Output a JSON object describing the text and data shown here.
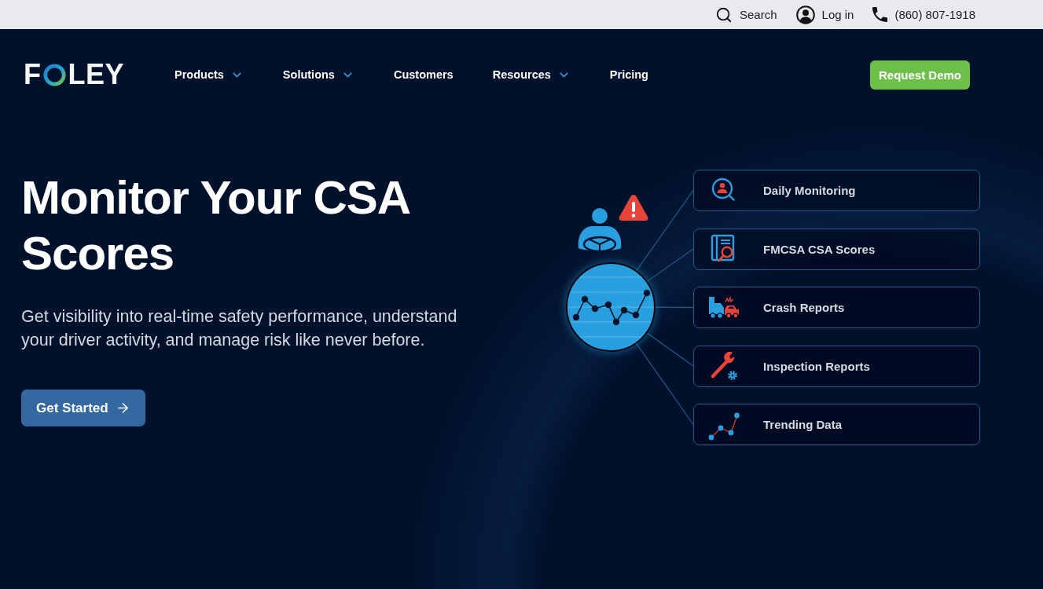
{
  "utility_bar": {
    "items": [
      {
        "kind": "search",
        "label": "Search"
      },
      {
        "kind": "account",
        "label": "Log in"
      },
      {
        "kind": "phone",
        "label": "(860) 807-1918"
      }
    ]
  },
  "nav": {
    "logo": {
      "before": "F",
      "after": "LEY"
    },
    "links": [
      {
        "label": "Products",
        "dropdown": true
      },
      {
        "label": "Solutions",
        "dropdown": true
      },
      {
        "label": "Customers",
        "dropdown": false
      },
      {
        "label": "Resources",
        "dropdown": true
      },
      {
        "label": "Pricing",
        "dropdown": false
      }
    ],
    "cta": "Request Demo"
  },
  "hero": {
    "title": "Monitor Your CSA Scores",
    "subtitle": "Get visibility into real-time safety performance, understand your driver activity, and manage risk like never before.",
    "button": "Get Started"
  },
  "features": [
    {
      "kind": "monitoring",
      "label": "Daily Monitoring"
    },
    {
      "kind": "scores",
      "label": "FMCSA CSA Scores"
    },
    {
      "kind": "crash",
      "label": "Crash Reports"
    },
    {
      "kind": "inspection",
      "label": "Inspection Reports"
    },
    {
      "kind": "trending",
      "label": "Trending Data"
    }
  ]
}
